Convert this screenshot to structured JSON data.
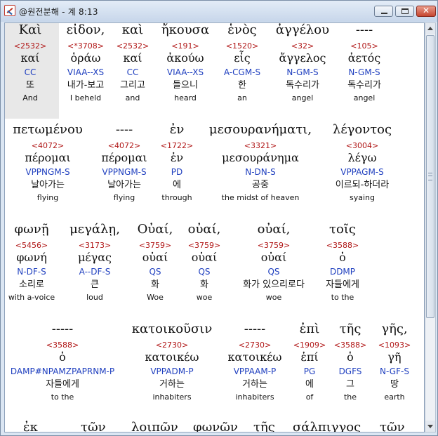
{
  "window": {
    "title": "@원전분해 - 계 8:13",
    "controls": {
      "minimize": "",
      "maximize": "",
      "close": "✕"
    }
  },
  "rows": [
    [
      {
        "greek": "Καὶ",
        "strongs": "<2532>",
        "lemma": "καί",
        "parsing": "CC",
        "korean": "또",
        "english": "And"
      },
      {
        "greek": "εἶδον,",
        "strongs": "<*3708>",
        "lemma": "ὁράω",
        "parsing": "VIAA--XS",
        "korean": "내가-보고",
        "english": "I beheld"
      },
      {
        "greek": "καὶ",
        "strongs": "<2532>",
        "lemma": "καί",
        "parsing": "CC",
        "korean": "그리고",
        "english": "and"
      },
      {
        "greek": "ἤκουσα",
        "strongs": "<191>",
        "lemma": "ἀκούω",
        "parsing": "VIAA--XS",
        "korean": "들으니",
        "english": "heard"
      },
      {
        "greek": "ἑνὸς",
        "strongs": "<1520>",
        "lemma": "εἷς",
        "parsing": "A-CGM-S",
        "korean": "한",
        "english": "an"
      },
      {
        "greek": "ἀγγέλου",
        "strongs": "<32>",
        "lemma": "ἄγγελος",
        "parsing": "N-GM-S",
        "korean": "독수리가",
        "english": "angel"
      },
      {
        "greek": "----",
        "strongs": "<105>",
        "lemma": "ἀετός",
        "parsing": "N-GM-S",
        "korean": "독수리가",
        "english": "angel"
      }
    ],
    [
      {
        "greek": "πετωμένου",
        "strongs": "<4072>",
        "lemma": "πέρομαι",
        "parsing": "VPPNGM-S",
        "korean": "날아가는",
        "english": "flying"
      },
      {
        "greek": "----",
        "strongs": "<4072>",
        "lemma": "πέρομαι",
        "parsing": "VPPNGM-S",
        "korean": "날아가는",
        "english": "flying"
      },
      {
        "greek": "ἐν",
        "strongs": "<1722>",
        "lemma": "ἐν",
        "parsing": "PD",
        "korean": "에",
        "english": "through"
      },
      {
        "greek": "μεσουρανήματι,",
        "strongs": "<3321>",
        "lemma": "μεσουράνημα",
        "parsing": "N-DN-S",
        "korean": "공중",
        "english": "the midst of heaven"
      },
      {
        "greek": "λέγοντος",
        "strongs": "<3004>",
        "lemma": "λέγω",
        "parsing": "VPPAGM-S",
        "korean": "이르되-하더라",
        "english": "syaing"
      }
    ],
    [
      {
        "greek": "φωνῇ",
        "strongs": "<5456>",
        "lemma": "φωνή",
        "parsing": "N-DF-S",
        "korean": "소리로",
        "english": "with a-voice"
      },
      {
        "greek": "μεγάλῃ,",
        "strongs": "<3173>",
        "lemma": "μέγας",
        "parsing": "A--DF-S",
        "korean": "큰",
        "english": "loud"
      },
      {
        "greek": "Οὐαί,",
        "strongs": "<3759>",
        "lemma": "οὐαί",
        "parsing": "QS",
        "korean": "화",
        "english": "Woe"
      },
      {
        "greek": "οὐαί,",
        "strongs": "<3759>",
        "lemma": "οὐαί",
        "parsing": "QS",
        "korean": "화",
        "english": "woe"
      },
      {
        "greek": "οὐαί,",
        "strongs": "<3759>",
        "lemma": "οὐαί",
        "parsing": "QS",
        "korean": "화가 있으리로다",
        "english": "woe"
      },
      {
        "greek": "τοῖς",
        "strongs": "<3588>",
        "lemma": "ὁ",
        "parsing": "DDMP",
        "korean": "자들에게",
        "english": "to the"
      }
    ],
    [
      {
        "greek": "-----",
        "strongs": "<3588>",
        "lemma": "ὁ",
        "parsing": "DAMP#NPAMZPAPRNM-P",
        "korean": "자들에게",
        "english": "to the"
      },
      {
        "greek": "κατοικοῦσιν",
        "strongs": "<2730>",
        "lemma": "κατοικέω",
        "parsing": "VPPADM-P",
        "korean": "거하는",
        "english": "inhabiters"
      },
      {
        "greek": "-----",
        "strongs": "<2730>",
        "lemma": "κατοικέω",
        "parsing": "VPPAAM-P",
        "korean": "거하는",
        "english": "inhabiters"
      },
      {
        "greek": "ἐπὶ",
        "strongs": "<1909>",
        "lemma": "ἐπί",
        "parsing": "PG",
        "korean": "에",
        "english": "of"
      },
      {
        "greek": "τῆς",
        "strongs": "<3588>",
        "lemma": "ὁ",
        "parsing": "DGFS",
        "korean": "그",
        "english": "the"
      },
      {
        "greek": "γῆς,",
        "strongs": "<1093>",
        "lemma": "γῆ",
        "parsing": "N-GF-S",
        "korean": "땅",
        "english": "earth"
      }
    ]
  ],
  "partial_row": [
    "ἐκ",
    "τῶν",
    "λοιπῶν",
    "φωνῶν",
    "τῆς",
    "σάλπιγγος",
    "τῶν"
  ]
}
